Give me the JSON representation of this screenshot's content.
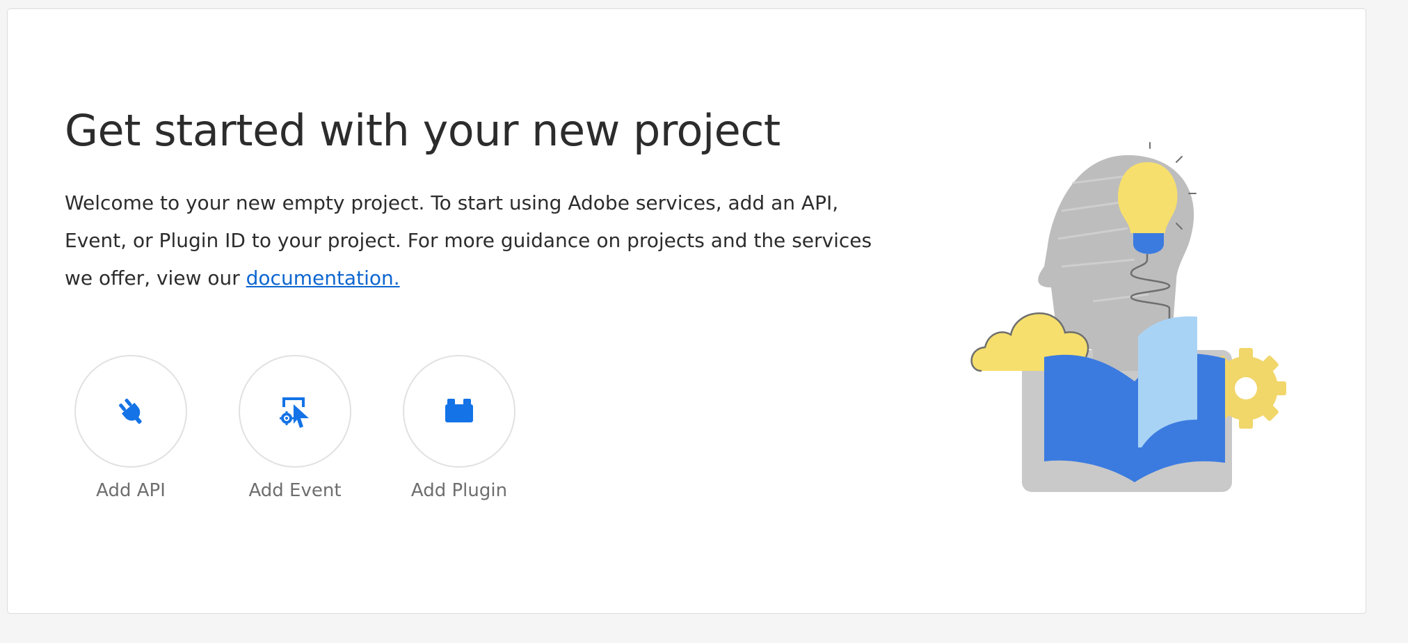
{
  "heading": "Get started with your new project",
  "description": {
    "text": "Welcome to your new empty project. To start using Adobe services, add an API, Event, or Plugin ID to your project. For more guidance on projects and the services we offer, view our ",
    "link": "documentation."
  },
  "actions": [
    {
      "label": "Add API",
      "icon": "plug-icon"
    },
    {
      "label": "Add Event",
      "icon": "event-icon"
    },
    {
      "label": "Add Plugin",
      "icon": "plugin-block-icon"
    }
  ],
  "colors": {
    "accent": "#1473e6",
    "link": "#0d66d0",
    "bulb": "#f7df6e",
    "book_blue": "#3b7be0",
    "gray": "#c8c8c8"
  }
}
